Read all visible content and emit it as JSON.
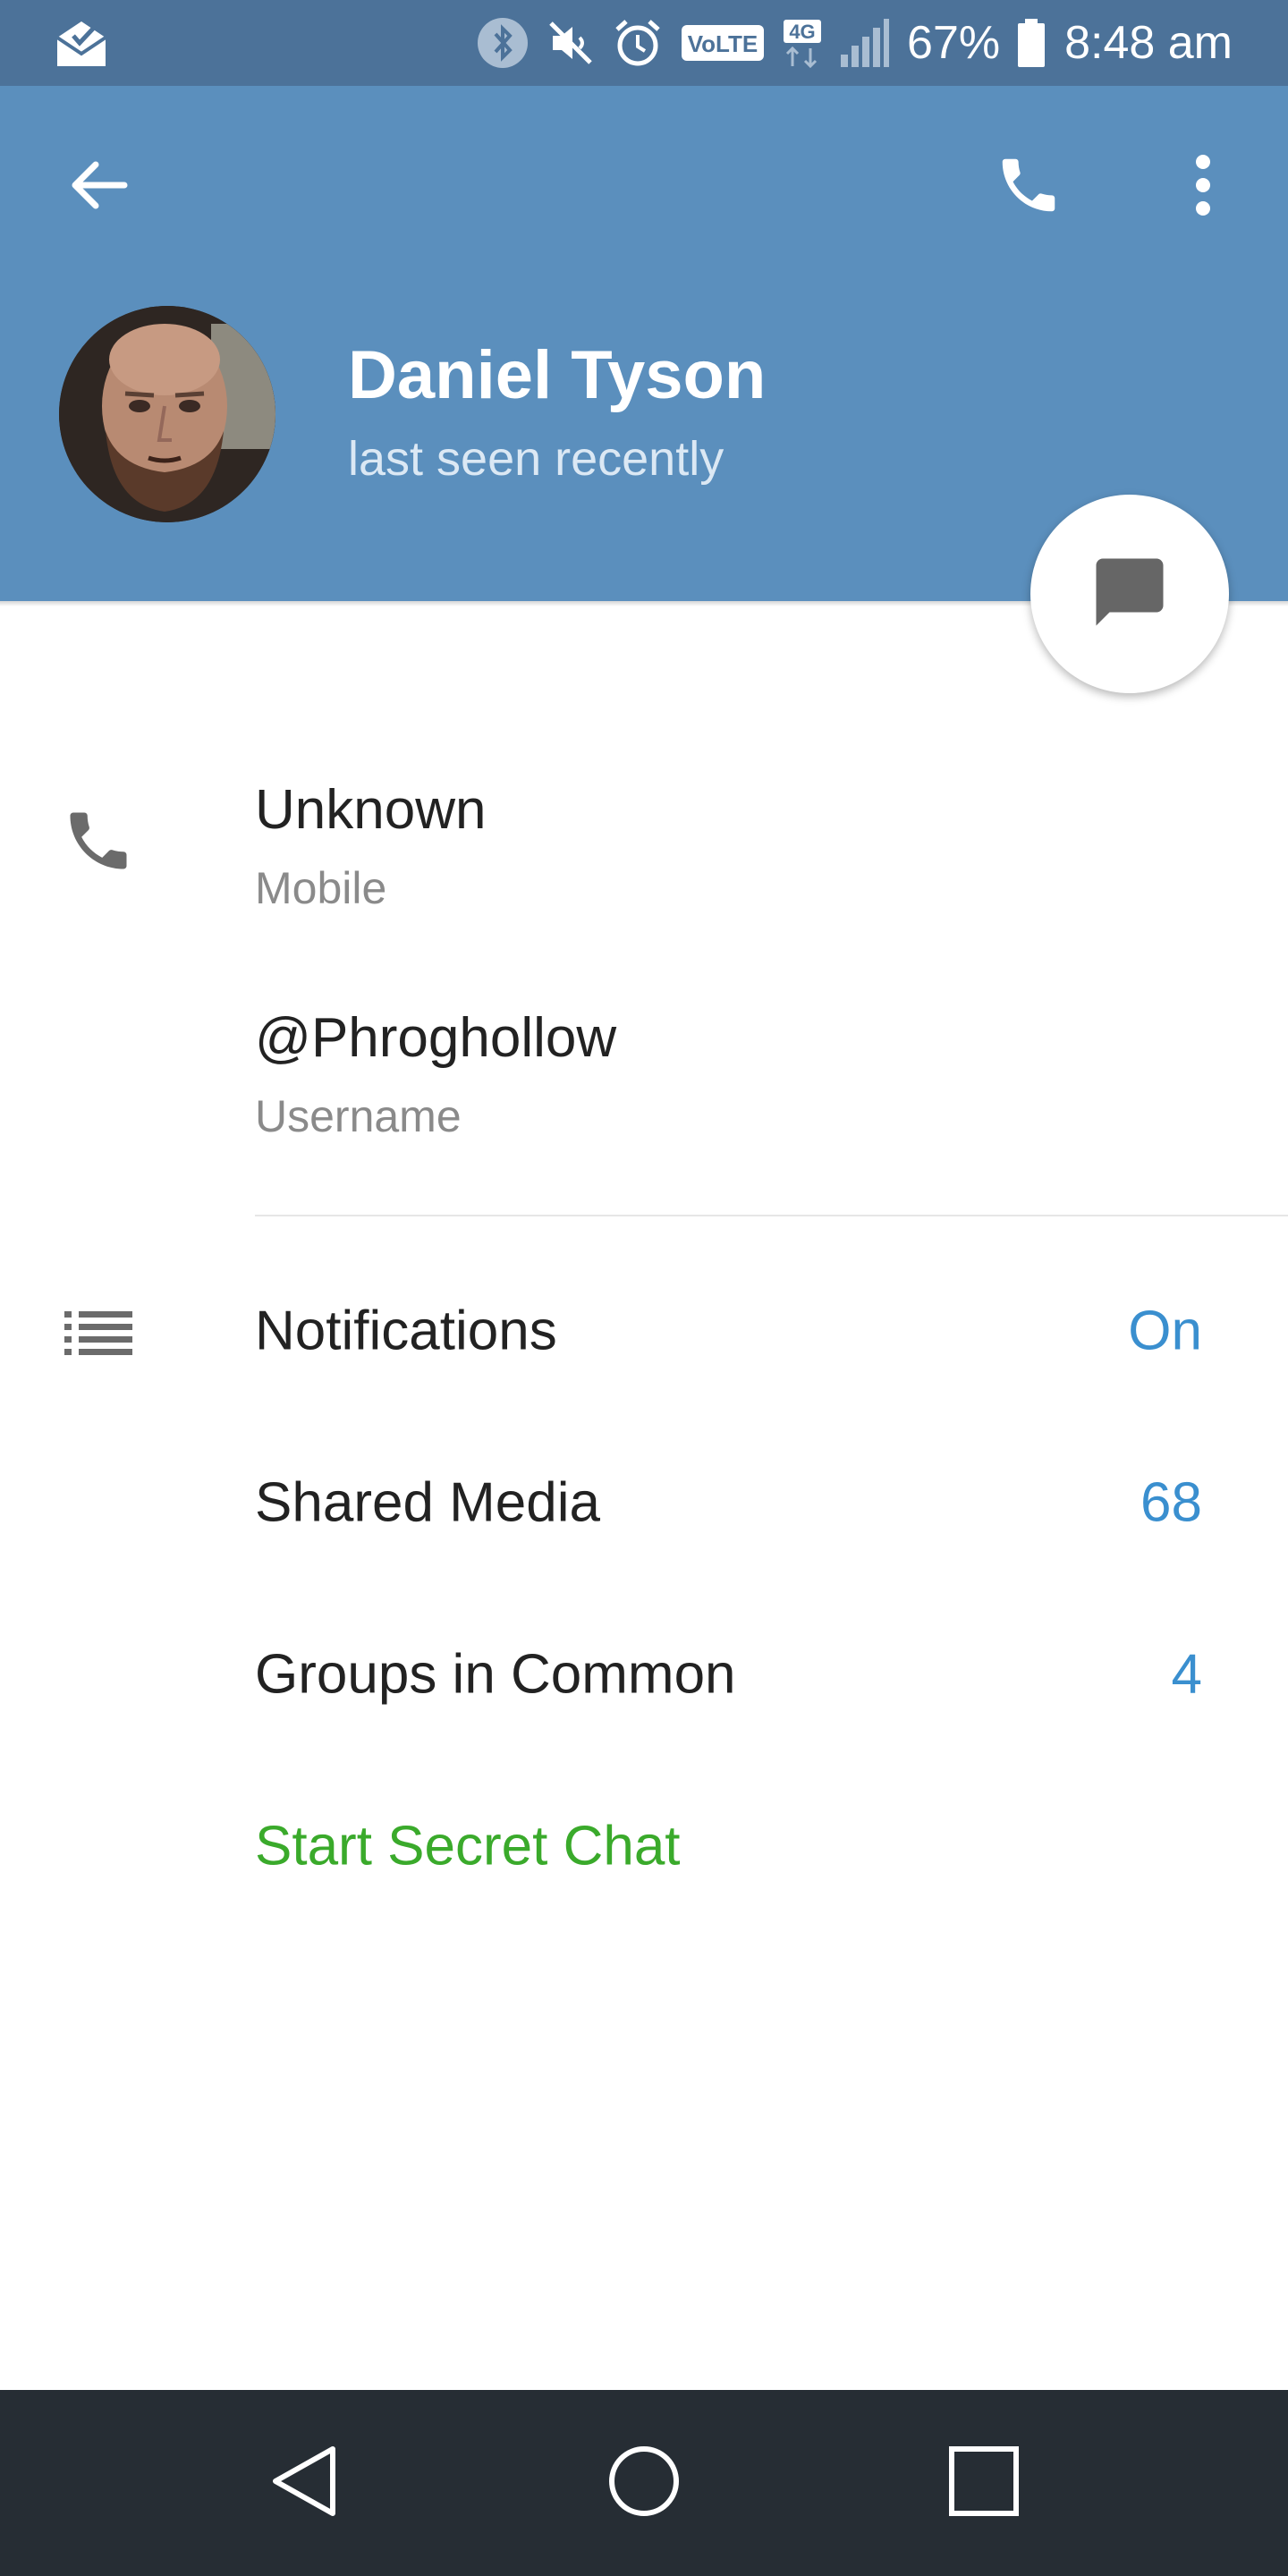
{
  "status_bar": {
    "battery_percent": "67%",
    "time": "8:48 am",
    "network_label": "4G",
    "volte_label": "VoLTE",
    "icons": [
      "mail-open-icon",
      "bluetooth-icon",
      "mute-icon",
      "alarm-icon",
      "volte-icon",
      "network-4g-icon",
      "signal-icon",
      "battery-icon"
    ]
  },
  "header": {
    "name": "Daniel Tyson",
    "status": "last seen recently",
    "actions": [
      "back-arrow-icon",
      "phone-icon",
      "more-vertical-icon"
    ],
    "fab_icon": "message-icon",
    "color": "#5b8fbd"
  },
  "info": {
    "phone": {
      "value": "Unknown",
      "label": "Mobile"
    },
    "username": {
      "value": "@Phroghollow",
      "label": "Username"
    }
  },
  "settings": {
    "notifications": {
      "label": "Notifications",
      "value": "On"
    },
    "shared_media": {
      "label": "Shared Media",
      "value": "68"
    },
    "groups": {
      "label": "Groups in Common",
      "value": "4"
    },
    "secret_chat": {
      "label": "Start Secret Chat"
    }
  },
  "colors": {
    "accent_blue": "#3a8fcf",
    "secret_green": "#3aaa2b",
    "status_bar": "#4c7299",
    "nav_bar": "#262d34"
  },
  "nav_bar": {
    "buttons": [
      "nav-back-icon",
      "nav-home-icon",
      "nav-recents-icon"
    ]
  }
}
